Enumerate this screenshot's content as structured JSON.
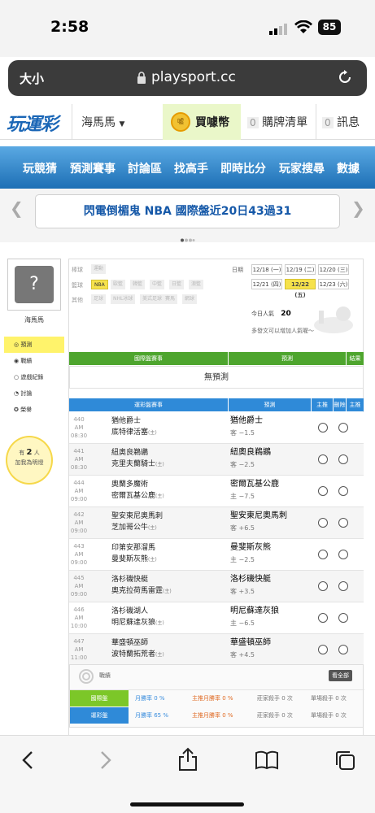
{
  "status": {
    "time": "2:58",
    "battery": "85"
  },
  "browser": {
    "text_size": "大小",
    "url": "playsport.cc"
  },
  "header": {
    "logo": "玩運彩",
    "user": "海馬馬",
    "coin": "買噱幣",
    "cart_count": "0",
    "cart_label": "購牌清單",
    "msg_count": "0",
    "msg_label": "訊息"
  },
  "nav": [
    "玩競猜",
    "預測賽事",
    "討論區",
    "找高手",
    "即時比分",
    "玩家搜尋",
    "數據"
  ],
  "banner": {
    "text": "閃電倒楣鬼 NBA 國際盤近20日43過31",
    "arrow_left": "❮",
    "arrow_right": "❯"
  },
  "sidebar": {
    "name": "海馬馬",
    "items": [
      "預測",
      "戰績",
      "遊戲紀錄",
      "討論",
      "榮譽"
    ],
    "fans": {
      "pre": "有",
      "count": "2",
      "unit": "人",
      "label": "加我為明燈"
    }
  },
  "filters": {
    "baseball_label": "棒球",
    "baseball": [
      "運動"
    ],
    "basketball_label": "籃球",
    "basketball": [
      "NBA",
      "歐籃",
      "韓籃",
      "中籃",
      "日籃",
      "澳籃"
    ],
    "other_label": "其他",
    "other": [
      "足球",
      "NHL冰球",
      "美式足球",
      "賽馬",
      "網球"
    ]
  },
  "dates": {
    "label": "日期",
    "row1": [
      "12/18 (一)",
      "12/19 (二)",
      "12/20 (三)"
    ],
    "row2": [
      "12/21 (四)",
      "12/22 (五)",
      "12/23 (六)"
    ]
  },
  "popularity": {
    "label": "今日人氣",
    "value": "20",
    "note": "多發文可以增加人氣喔～"
  },
  "intl": {
    "col1": "國際盤賽事",
    "col2": "預測",
    "col3": "結果",
    "empty": "無預測"
  },
  "lottery": {
    "col1": "運彩盤賽事",
    "col2": "預測",
    "col3": "主推",
    "col4": "刪除",
    "games": [
      {
        "no": "440",
        "time": "AM 08:30",
        "t1": "猶他爵士",
        "t2": "底特律活塞",
        "pick": "猶他爵士",
        "line": "客 −1.5"
      },
      {
        "no": "441",
        "time": "AM 08:30",
        "t1": "紐奧良鵜鶘",
        "t2": "克里夫蘭騎士",
        "pick": "紐奧良鵜鶘",
        "line": "客 −2.5"
      },
      {
        "no": "444",
        "time": "AM 09:00",
        "t1": "奧蘭多魔術",
        "t2": "密爾瓦基公鹿",
        "pick": "密爾瓦基公鹿",
        "line": "主 −7.5"
      },
      {
        "no": "442",
        "time": "AM 09:00",
        "t1": "聖安東尼奧馬刺",
        "t2": "芝加哥公牛",
        "pick": "聖安東尼奧馬刺",
        "line": "客 +6.5"
      },
      {
        "no": "443",
        "time": "AM 09:00",
        "t1": "印第安那溜馬",
        "t2": "曼斐斯灰熊",
        "pick": "曼斐斯灰熊",
        "line": "主 −2.5"
      },
      {
        "no": "445",
        "time": "AM 09:00",
        "t1": "洛杉磯快艇",
        "t2": "奧克拉荷馬雷霆",
        "pick": "洛杉磯快艇",
        "line": "客 +3.5"
      },
      {
        "no": "446",
        "time": "AM 10:00",
        "t1": "洛杉磯湖人",
        "t2": "明尼蘇達灰狼",
        "pick": "明尼蘇達灰狼",
        "line": "主 −6.5"
      },
      {
        "no": "447",
        "time": "AM 11:00",
        "t1": "華盛頓巫師",
        "t2": "波特蘭拓荒者",
        "pick": "華盛頓巫師",
        "line": "客 +4.5"
      }
    ]
  },
  "record": {
    "title": "戰績",
    "view_all": "看全部",
    "rows": [
      {
        "label": "國際盤",
        "month": "月勝率 0 %",
        "main": "主推月勝率 0 %",
        "kill": "莊家殺手 0 次",
        "hit": "單場殺手 0 次"
      },
      {
        "label": "運彩盤",
        "month": "月勝率 65 %",
        "main": "主推月勝率 0 %",
        "kill": "莊家殺手 0 次",
        "hit": "單場殺手 0 次"
      }
    ]
  }
}
